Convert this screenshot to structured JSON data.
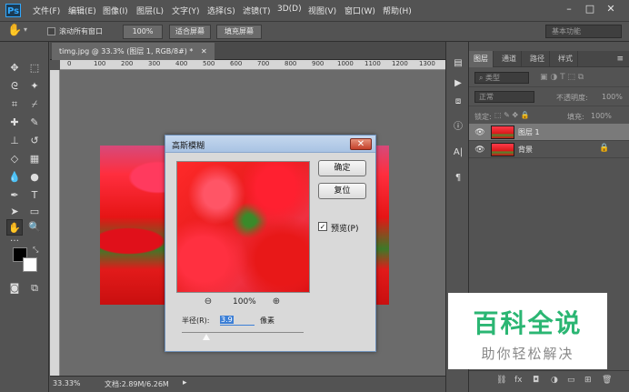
{
  "menu": {
    "logo": "Ps",
    "items": [
      "文件(F)",
      "编辑(E)",
      "图像(I)",
      "图层(L)",
      "文字(Y)",
      "选择(S)",
      "滤镜(T)",
      "3D(D)",
      "视图(V)",
      "窗口(W)",
      "帮助(H)"
    ],
    "window_controls": [
      "–",
      "□",
      "✕"
    ]
  },
  "options": {
    "scroll_all_label": "滚动所有窗口",
    "zoom_value": "100%",
    "fit_screen_label": "适合屏幕",
    "fill_screen_label": "填充屏幕",
    "workspace": "基本功能"
  },
  "document": {
    "tab_title": "timg.jpg @ 33.3% (图层 1, RGB/8#) *",
    "ruler_marks": [
      "0",
      "100",
      "200",
      "300",
      "400",
      "500",
      "600",
      "700",
      "800",
      "900",
      "1000",
      "1100",
      "1200",
      "1300"
    ],
    "zoom": "33.33%",
    "doc_info": "文档:2.89M/6.26M"
  },
  "layers_panel": {
    "tabs": [
      "图层",
      "通道",
      "路径",
      "样式"
    ],
    "filter_kind": "类型",
    "blend_mode": "正常",
    "opacity_label": "不透明度:",
    "opacity_value": "100%",
    "lock_label": "锁定:",
    "fill_label": "填充:",
    "fill_value": "100%",
    "layers": [
      {
        "name": "图层 1",
        "selected": true
      },
      {
        "name": "背景",
        "selected": false
      }
    ]
  },
  "dialog": {
    "title": "高斯模糊",
    "ok_label": "确定",
    "reset_label": "复位",
    "preview_label": "预览(P)",
    "preview_checked": "✓",
    "zoom_level": "100%",
    "radius_label": "半径(R):",
    "radius_value": "3.9",
    "unit": "像素"
  },
  "watermark": {
    "main": "百科全说",
    "sub": "助你轻松解决"
  }
}
